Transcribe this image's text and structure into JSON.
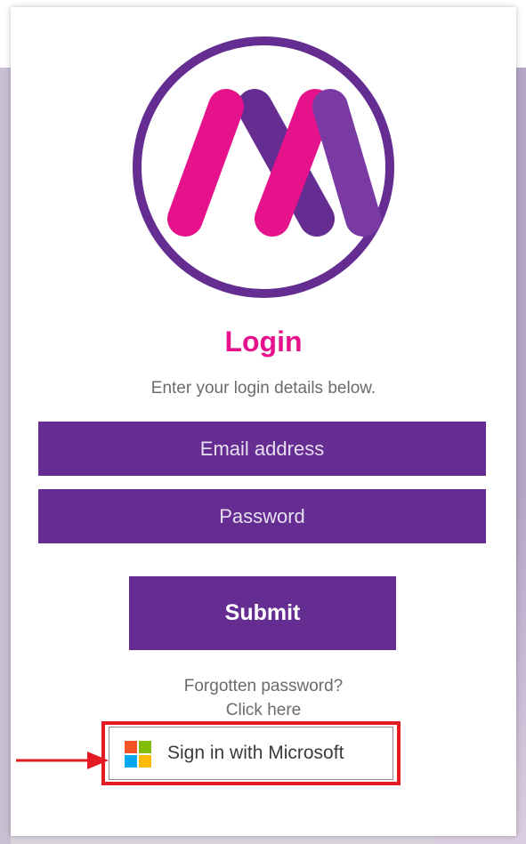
{
  "login": {
    "title": "Login",
    "subtitle": "Enter your login details below.",
    "email_placeholder": "Email address",
    "password_placeholder": "Password",
    "submit_label": "Submit",
    "forgot_line1": "Forgotten password?",
    "forgot_line2": "Click here",
    "microsoft_label": "Sign in with Microsoft"
  },
  "colors": {
    "brand_purple": "#652d91",
    "brand_pink": "#e6128c",
    "highlight_red": "#e51b24"
  },
  "icons": {
    "logo": "m-circle-logo",
    "microsoft": "microsoft-logo-icon",
    "annotation": "red-arrow-icon"
  }
}
